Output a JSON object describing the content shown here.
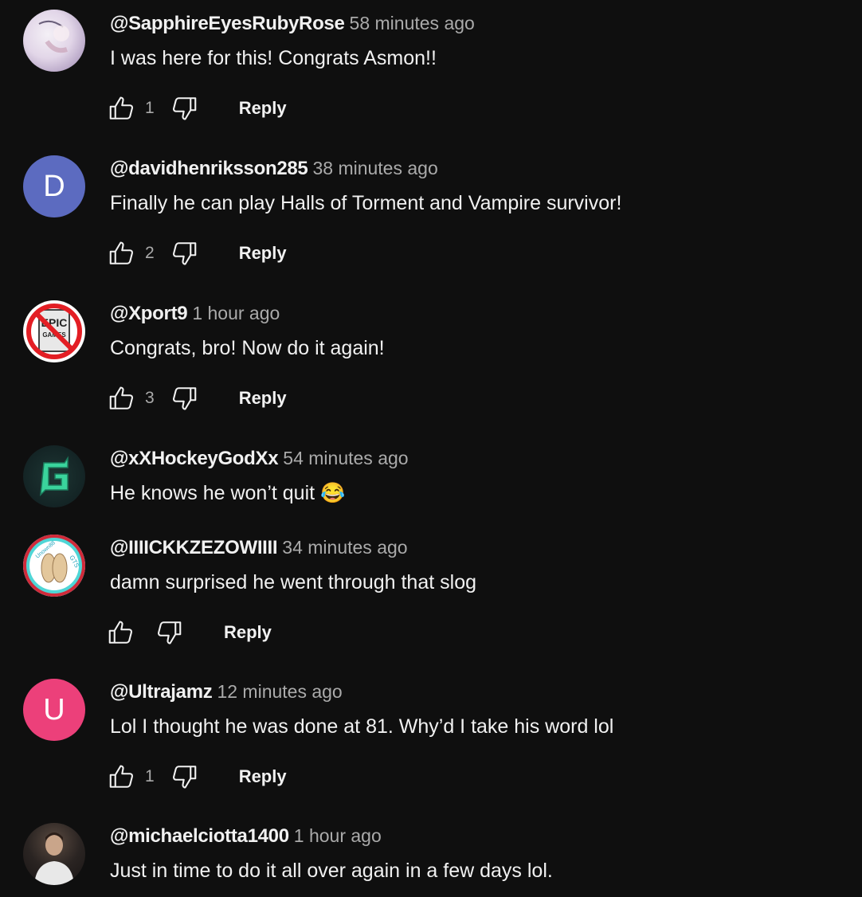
{
  "comments": [
    {
      "author": "@SapphireEyesRubyRose",
      "time": "58 minutes ago",
      "text": "I was here for this! Congrats Asmon!!",
      "likes": "1",
      "avatar": {
        "type": "image",
        "icon": "anime-art-avatar",
        "color": "#d8d0e0"
      },
      "reply_label": "Reply"
    },
    {
      "author": "@davidhenriksson285",
      "time": "38 minutes ago",
      "text": "Finally he can play Halls of Torment and Vampire survivor!",
      "likes": "2",
      "avatar": {
        "type": "letter",
        "letter": "D",
        "color": "#5c6bc0"
      },
      "reply_label": "Reply"
    },
    {
      "author": "@Xport9",
      "time": "1 hour ago",
      "text": "Congrats, bro! Now do it again!",
      "likes": "3",
      "avatar": {
        "type": "image",
        "icon": "no-epic-games-avatar",
        "color": "#ffffff"
      },
      "reply_label": "Reply"
    },
    {
      "author": "@xXHockeyGodXx",
      "time": "54 minutes ago",
      "text": "He knows he won’t quit 😂",
      "likes": "",
      "avatar": {
        "type": "image",
        "icon": "green-g-logo-avatar",
        "color": "#1a2a2a"
      },
      "reply_label": ""
    },
    {
      "author": "@IIIICKKZEZOWIIII",
      "time": "34 minutes ago",
      "text": "damn surprised he went through that slog",
      "likes": "",
      "avatar": {
        "type": "image",
        "icon": "feet-badge-avatar",
        "color": "#ffffff"
      },
      "reply_label": "Reply"
    },
    {
      "author": "@Ultrajamz",
      "time": "12 minutes ago",
      "text": "Lol I thought he was done at 81. Why’d I take his word lol",
      "likes": "1",
      "avatar": {
        "type": "letter",
        "letter": "U",
        "color": "#ec407a"
      },
      "reply_label": "Reply"
    },
    {
      "author": "@michaelciotta1400",
      "time": "1 hour ago",
      "text": "Just in time to do it all over again in a few days lol.",
      "likes": "",
      "avatar": {
        "type": "image",
        "icon": "photo-avatar",
        "color": "#3a3a3a"
      },
      "reply_label": ""
    }
  ]
}
